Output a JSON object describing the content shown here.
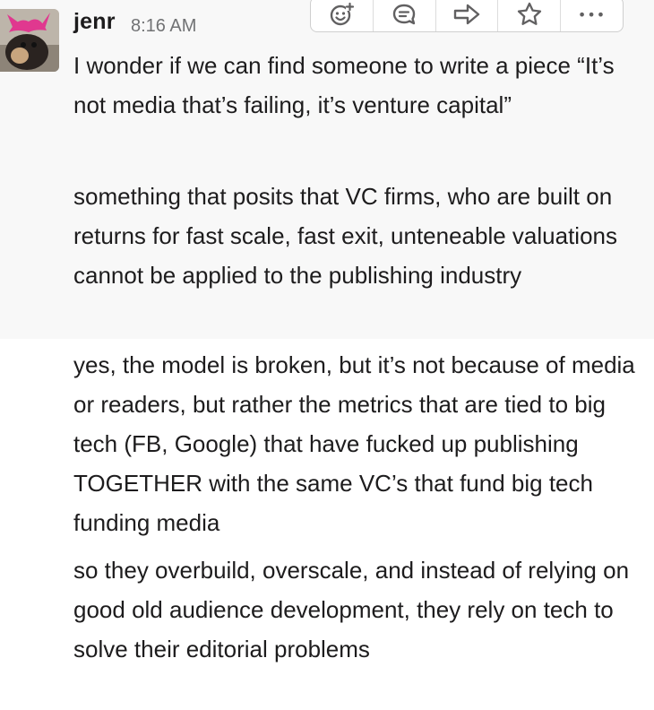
{
  "message": {
    "author": "jenr",
    "timestamp": "8:16 AM",
    "avatar_icon": "dog-with-pink-hat-avatar"
  },
  "toolbar": {
    "items": [
      {
        "icon": "add-reaction-icon"
      },
      {
        "icon": "start-thread-icon"
      },
      {
        "icon": "share-message-icon"
      },
      {
        "icon": "star-icon"
      },
      {
        "icon": "more-actions-icon",
        "glyph": "•••"
      }
    ]
  },
  "messages": [
    "I wonder if we can find someone to write a piece “It’s not media that’s failing, it’s venture capital”",
    "something that posits that VC firms, who are built on returns for fast scale, fast exit, unteneable valuations cannot be applied to the publishing industry",
    "yes, the model is broken, but it’s not because of media or readers, but rather the metrics that are tied to big tech (FB, Google) that have fucked up publishing TOGETHER with the same VC’s that fund big tech funding media",
    "so they overbuild, overscale, and instead of relying on good old audience development, they rely on tech to solve their editorial problems"
  ],
  "colors": {
    "hover_background": "#f8f8f8",
    "text": "#1d1c1d",
    "timestamp": "#717274",
    "icon": "#616061"
  }
}
